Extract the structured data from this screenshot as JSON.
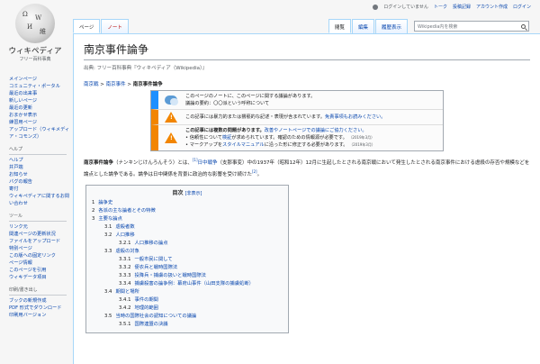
{
  "logo": {
    "title": "ウィキペディア",
    "subtitle": "フリー百科事典"
  },
  "personal": {
    "not_logged_in": "ログインしていません",
    "talk": "トーク",
    "contributions": "投稿記録",
    "create_account": "アカウント作成",
    "login": "ログイン"
  },
  "tabs": {
    "page": "ページ",
    "note": "ノート",
    "read": "閲覧",
    "edit": "編集",
    "history": "履歴表示"
  },
  "search": {
    "placeholder": "Wikipedia内を検索"
  },
  "sidebar": {
    "main": [
      "メインページ",
      "コミュニティ・ポータル",
      "最近の出来事",
      "新しいページ",
      "最近の更新",
      "おまかせ表示",
      "練習用ページ",
      "アップロード（ウィキメディア・コモンズ）"
    ],
    "help_heading": "ヘルプ",
    "help": [
      "ヘルプ",
      "井戸端",
      "お知らせ",
      "バグの報告",
      "寄付",
      "ウィキペディアに関するお問い合わせ"
    ],
    "tools_heading": "ツール",
    "tools": [
      "リンク元",
      "関連ページの更新状況",
      "ファイルをアップロード",
      "特別ページ",
      "この版への固定リンク",
      "ページ情報",
      "このページを引用",
      "ウィキデータ項目"
    ],
    "print_heading": "印刷/書き出し",
    "print": [
      "ブックの新規作成",
      "PDF 形式でダウンロード",
      "印刷用バージョン"
    ]
  },
  "article": {
    "title": "南京事件論争",
    "tagline": "出典: フリー百科事典『ウィキペディア（Wikipedia）』",
    "breadcrumb": [
      "南京戦",
      "南京事件",
      "南京事件論争"
    ],
    "breadcrumb_sep": " > "
  },
  "ambox": {
    "note_line1": "このページのノートに、このページに関する議論があります。",
    "note_line2": "議論の要約：〇〇派という呼称について",
    "violence_text": "この記事には暴力的または猥褻的な記述・表現が含まれています。",
    "violence_link": "免責事項もお読みください。",
    "issues_head": "この記事には複数の問題があります。",
    "issues_link": "改善やノートページでの議論にご協力ください。",
    "issue1_a": "信頼性について",
    "issue1_link": "検証",
    "issue1_b": "が求められています。確認のための情報源が必要です。",
    "issue1_date": "（2019年3月）",
    "issue2_a": "マークアップを",
    "issue2_link": "スタイルマニュアル",
    "issue2_b": "に沿った形に修正する必要があります。",
    "issue2_date": "（2019年3月）"
  },
  "lead": {
    "bold": "南京事件論争",
    "p1": "（ナンキンじけんろんそう）とは、",
    "link1": "日中戦争",
    "p2": "（支那事変）中の1937年（昭和12年）12月に",
    "p3": "生起したとされる南京戦において発生したとされる南京事件における虐殺の存否や規模などを論点とした論争である。論争は日中関係を背景に政治的な影響を受け続けた",
    "ref1": "[1]",
    "ref2": "[2]",
    "end": "。"
  },
  "toc": {
    "title": "目次",
    "hide": "[非表示]",
    "items": [
      {
        "num": "1",
        "label": "論争史",
        "level": 1
      },
      {
        "num": "2",
        "label": "各派の主な論者とその特徴",
        "level": 1
      },
      {
        "num": "3",
        "label": "主要な論点",
        "level": 1
      },
      {
        "num": "3.1",
        "label": "虐殺者数",
        "level": 2
      },
      {
        "num": "3.2",
        "label": "人口推移",
        "level": 2
      },
      {
        "num": "3.2.1",
        "label": "人口推移の論点",
        "level": 3
      },
      {
        "num": "3.3",
        "label": "虐殺の対象",
        "level": 2
      },
      {
        "num": "3.3.1",
        "label": "一般市民に関して",
        "level": 3
      },
      {
        "num": "3.3.2",
        "label": "便衣兵と戦時国際法",
        "level": 3
      },
      {
        "num": "3.3.3",
        "label": "投降兵・捕虜の扱いと戦時国際法",
        "level": 3
      },
      {
        "num": "3.3.4",
        "label": "捕虜殺害の論争例：幕府山事件（山田支隊の捕虜処断）",
        "level": 3
      },
      {
        "num": "3.4",
        "label": "期間と場所",
        "level": 2
      },
      {
        "num": "3.4.1",
        "label": "事件の期間",
        "level": 3
      },
      {
        "num": "3.4.2",
        "label": "地理的範囲",
        "level": 3
      },
      {
        "num": "3.5",
        "label": "当時の国際社会の認知についての議論",
        "level": 2
      },
      {
        "num": "3.5.1",
        "label": "国際連盟の決議",
        "level": 3
      }
    ]
  }
}
